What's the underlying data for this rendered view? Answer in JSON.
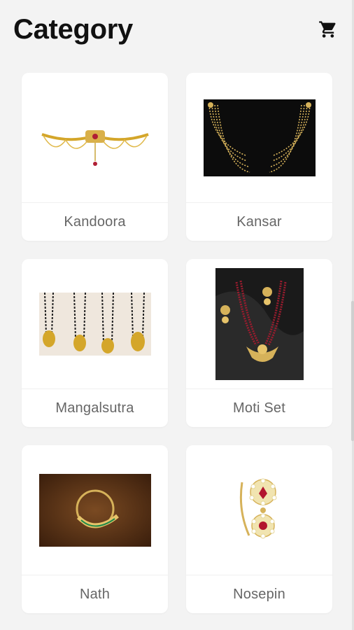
{
  "header": {
    "title": "Category",
    "cart_icon": "shopping-cart-icon"
  },
  "categories": [
    {
      "label": "Kandoora"
    },
    {
      "label": "Kansar"
    },
    {
      "label": "Mangalsutra"
    },
    {
      "label": "Moti Set"
    },
    {
      "label": "Nath"
    },
    {
      "label": "Nosepin"
    }
  ],
  "colors": {
    "background": "#f3f3f3",
    "card": "#ffffff",
    "title": "#111111",
    "label": "#666666",
    "gold": "#d4a62a"
  }
}
